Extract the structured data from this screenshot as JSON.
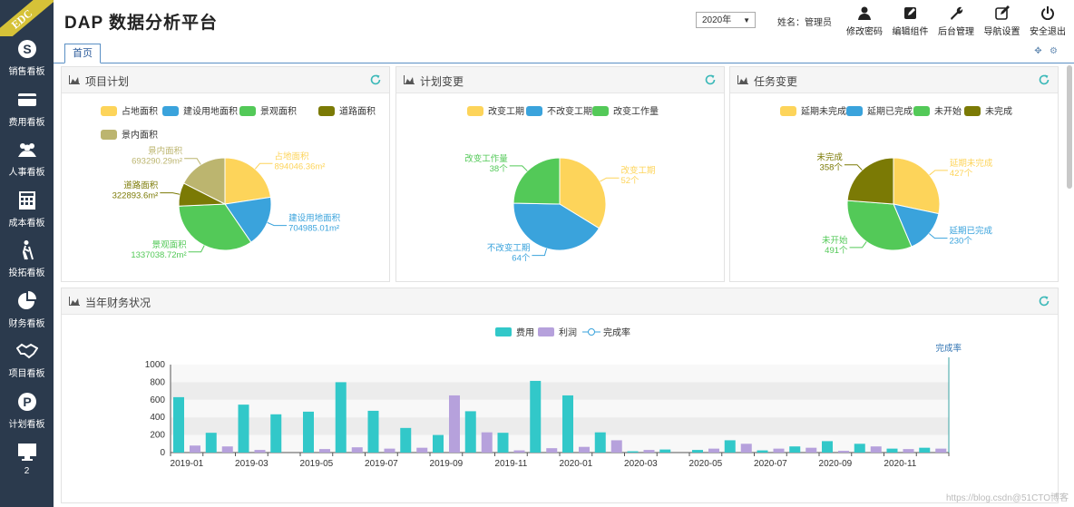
{
  "brand": {
    "ribbon": "EDC"
  },
  "app": {
    "title": "DAP 数据分析平台",
    "year": "2020年",
    "user": "姓名：管理员"
  },
  "sidebar": {
    "items": [
      {
        "label": "销售看板",
        "icon": "skype-icon"
      },
      {
        "label": "费用看板",
        "icon": "card-icon"
      },
      {
        "label": "人事看板",
        "icon": "people-icon"
      },
      {
        "label": "成本看板",
        "icon": "calculator-icon"
      },
      {
        "label": "投拓看板",
        "icon": "walker-icon"
      },
      {
        "label": "财务看板",
        "icon": "pie-icon"
      },
      {
        "label": "项目看板",
        "icon": "handshake-icon"
      },
      {
        "label": "计划看板",
        "icon": "parking-icon"
      },
      {
        "label": "2",
        "icon": "monitor-icon"
      }
    ]
  },
  "toolbar": [
    {
      "label": "修改密码",
      "icon": "user-icon"
    },
    {
      "label": "编辑组件",
      "icon": "edit-icon"
    },
    {
      "label": "后台管理",
      "icon": "wrench-icon"
    },
    {
      "label": "导航设置",
      "icon": "compose-icon"
    },
    {
      "label": "安全退出",
      "icon": "power-icon"
    }
  ],
  "tabs": {
    "home": "首页"
  },
  "panels": {
    "p1": "项目计划",
    "p2": "计划变更",
    "p3": "任务变更",
    "p4": "当年财务状况"
  },
  "colors": {
    "yellow": "#fdd45a",
    "blue": "#3aa3dc",
    "green": "#53c958",
    "olive": "#7b7a05",
    "khaki": "#bcb56f",
    "teal": "#32c8c9",
    "purple": "#b6a1dc",
    "sidebar": "#2b3a4d"
  },
  "chart_data": [
    {
      "type": "pie",
      "legend": [
        "占地面积",
        "建设用地面积",
        "景观面积",
        "道路面积",
        "景内面积"
      ],
      "slices": [
        {
          "name": "占地面积",
          "value": 894046.36,
          "label": "894046.36m²"
        },
        {
          "name": "建设用地面积",
          "value": 704985.01,
          "label": "704985.01m²"
        },
        {
          "name": "景观面积",
          "value": 1337038.72,
          "label": "1337038.72m²"
        },
        {
          "name": "道路面积",
          "value": 322893.6,
          "label": "322893.6m²"
        },
        {
          "name": "景内面积",
          "value": 693290.29,
          "label": "693290.29m²"
        }
      ]
    },
    {
      "type": "pie",
      "legend": [
        "改变工期",
        "不改变工期",
        "改变工作量"
      ],
      "slices": [
        {
          "name": "改变工期",
          "value": 52,
          "label": "52个"
        },
        {
          "name": "不改变工期",
          "value": 64,
          "label": "64个"
        },
        {
          "name": "改变工作量",
          "value": 38,
          "label": "38个"
        }
      ]
    },
    {
      "type": "pie",
      "legend": [
        "延期未完成",
        "延期已完成",
        "未开始",
        "未完成"
      ],
      "slices": [
        {
          "name": "延期未完成",
          "value": 427,
          "label": "427个"
        },
        {
          "name": "延期已完成",
          "value": 230,
          "label": "230个"
        },
        {
          "name": "未开始",
          "value": 491,
          "label": "491个"
        },
        {
          "name": "未完成",
          "value": 358,
          "label": "358个"
        }
      ]
    },
    {
      "type": "bar",
      "legend": [
        "费用",
        "利润",
        "完成率"
      ],
      "right_axis": "完成率",
      "ylim": [
        0,
        1000
      ],
      "yticks": [
        "0",
        "200",
        "400",
        "600",
        "800",
        "1000"
      ],
      "categories": [
        "2019-01",
        "2019-02",
        "2019-03",
        "2019-04",
        "2019-05",
        "2019-06",
        "2019-07",
        "2019-08",
        "2019-09",
        "2019-10",
        "2019-11",
        "2019-12",
        "2020-01",
        "2020-02",
        "2020-03",
        "2020-04",
        "2020-05",
        "2020-06",
        "2020-07",
        "2020-08",
        "2020-09",
        "2020-10",
        "2020-11",
        "2020-12"
      ],
      "xticks": [
        "2019-01",
        "2019-03",
        "2019-05",
        "2019-07",
        "2019-09",
        "2019-11",
        "2020-01",
        "2020-03",
        "2020-05",
        "2020-07",
        "2020-09",
        "2020-11"
      ],
      "series": [
        {
          "name": "费用",
          "values": [
            630,
            225,
            545,
            435,
            465,
            800,
            475,
            280,
            200,
            470,
            225,
            815,
            650,
            230,
            15,
            35,
            30,
            140,
            25,
            70,
            130,
            100,
            45,
            55
          ]
        },
        {
          "name": "利润",
          "values": [
            80,
            70,
            30,
            0,
            40,
            60,
            45,
            55,
            650,
            230,
            25,
            50,
            65,
            140,
            30,
            0,
            45,
            100,
            45,
            55,
            20,
            70,
            40,
            45
          ]
        }
      ]
    }
  ],
  "footer": {
    "watermark": "https://blog.csdn@51CTO博客"
  }
}
